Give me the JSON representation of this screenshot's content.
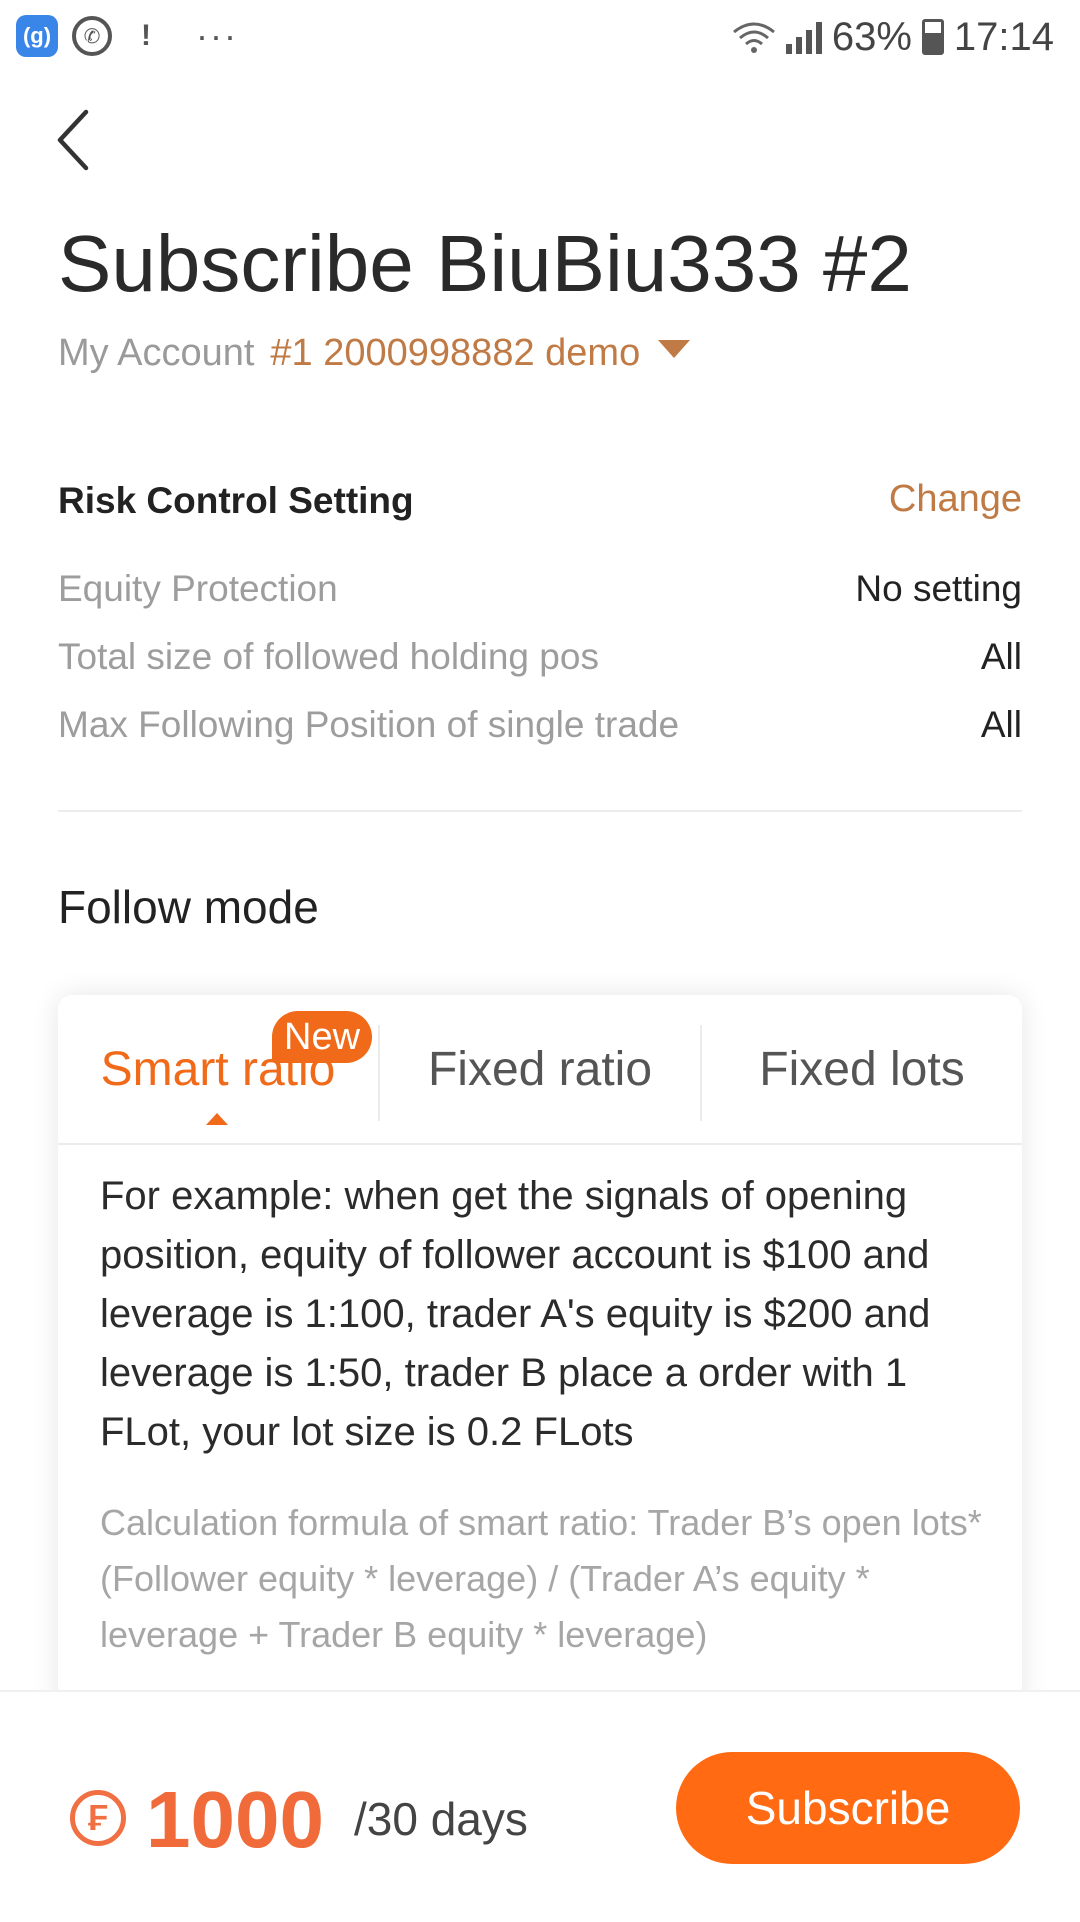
{
  "status_bar": {
    "app_icon_text": "(g)",
    "more": "···",
    "battery": "63%",
    "time": "17:14"
  },
  "header": {
    "title": "Subscribe BiuBiu333 #2",
    "account_label": "My Account",
    "account_value": "#1 2000998882 demo"
  },
  "risk_control": {
    "title": "Risk Control Setting",
    "change": "Change",
    "rows": [
      {
        "label": "Equity Protection",
        "value": "No setting"
      },
      {
        "label": "Total size of followed holding pos",
        "value": "All"
      },
      {
        "label": "Max Following Position of single trade",
        "value": "All"
      }
    ]
  },
  "follow_mode": {
    "title": "Follow mode",
    "tabs": [
      "Smart ratio",
      "Fixed ratio",
      "Fixed lots"
    ],
    "active_tab": "Smart ratio",
    "badge": "New",
    "example": "For example: when get the signals of opening position, equity of follower account is $100 and leverage is 1:100, trader A's equity is $200 and leverage is 1:50, trader B place a order with 1 FLot, your lot size is 0.2 FLots",
    "formula": "Calculation formula of smart ratio: Trader B’s open lots* (Follower equity * leverage) / (Trader A’s equity * leverage + Trader B equity * leverage)"
  },
  "footer": {
    "currency_symbol": "₣",
    "price": "1000",
    "period": "/30 days",
    "subscribe": "Subscribe"
  },
  "colors": {
    "accent": "#ff6a13",
    "link": "#c07a45",
    "muted": "#9d9d9d"
  },
  "icons": [
    "wifi-app-icon",
    "whatsapp-icon",
    "notification-icon",
    "wifi-icon",
    "signal-icon",
    "battery-icon",
    "back-chevron-icon",
    "caret-down-icon",
    "coin-icon"
  ]
}
